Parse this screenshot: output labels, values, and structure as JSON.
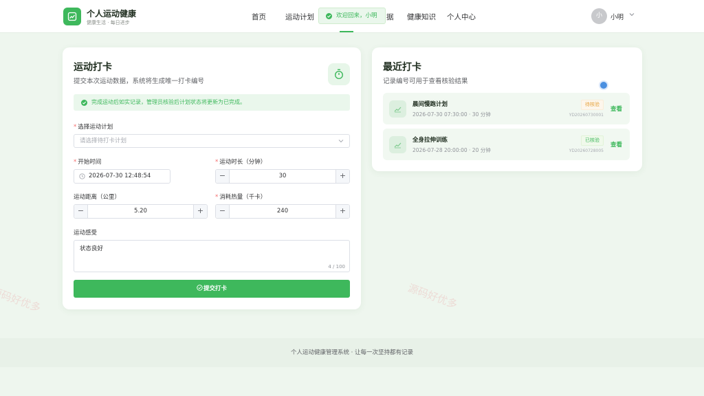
{
  "watermark": "源码好优多",
  "app": {
    "title": "个人运动健康",
    "subtitle": "健康生活 · 每日进步"
  },
  "nav": {
    "items": [
      "首页",
      "运动计划",
      "据",
      "健康知识",
      "个人中心"
    ]
  },
  "toast": {
    "message": "欢迎回来，小明"
  },
  "user": {
    "avatar_text": "小",
    "name": "小明"
  },
  "checkin": {
    "title": "运动打卡",
    "subtitle": "提交本次运动数据，系统将生成唯一打卡编号",
    "alert": "完成运动后如实记录，管理员核验后计划状态将更新为已完成。",
    "plan_label": "选择运动计划",
    "plan_placeholder": "请选择待打卡计划",
    "start_label": "开始时间",
    "start_value": "2026-07-30 12:48:54",
    "duration_label": "运动时长（分钟）",
    "duration_value": "30",
    "distance_label": "运动距离（公里）",
    "distance_value": "5.20",
    "calories_label": "消耗热量（千卡）",
    "calories_value": "240",
    "feeling_label": "运动感受",
    "feeling_value": "状态良好",
    "feeling_count": "4 / 100",
    "submit_label": "提交打卡",
    "minus": "−",
    "plus": "+"
  },
  "recent": {
    "title": "最近打卡",
    "subtitle": "记录编号可用于查看核验结果",
    "records": [
      {
        "name": "晨间慢跑计划",
        "meta": "2026-07-30 07:30:00 · 30 分钟",
        "status": "待核验",
        "code": "YD20260730001",
        "action": "查看"
      },
      {
        "name": "全身拉伸训练",
        "meta": "2026-07-28 20:00:00 · 20 分钟",
        "status": "已核验",
        "code": "YD20260728005",
        "action": "查看"
      }
    ]
  },
  "footer": {
    "text": "个人运动健康管理系统 · 让每一次坚持都有记录"
  },
  "colors": {
    "accent": "#3eb85c",
    "background": "#eef6ee",
    "pending": "#e6a23c"
  }
}
